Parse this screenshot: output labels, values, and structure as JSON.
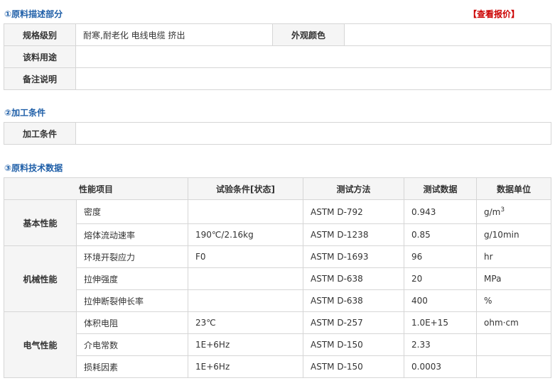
{
  "sections": {
    "desc_title": "①原料描述部分",
    "quote_link": "【查看报价】",
    "process_title": "②加工条件",
    "tech_title": "③原料技术数据"
  },
  "desc": {
    "spec_label": "规格级别",
    "spec_value": "耐寒,耐老化 电线电缆 挤出",
    "appearance_label": "外观颜色",
    "appearance_value": "",
    "usage_label": "该料用途",
    "usage_value": "",
    "remark_label": "备注说明",
    "remark_value": ""
  },
  "process": {
    "label": "加工条件",
    "value": ""
  },
  "tech": {
    "headers": [
      "性能项目",
      "试验条件[状态]",
      "测试方法",
      "测试数据",
      "数据单位"
    ],
    "groups": [
      {
        "name": "基本性能",
        "rows": [
          {
            "item": "密度",
            "cond": "",
            "method": "ASTM D-792",
            "value": "0.943",
            "unit": "g/m",
            "unit_sup": "3"
          },
          {
            "item": "熔体流动速率",
            "cond": "190℃/2.16kg",
            "method": "ASTM D-1238",
            "value": "0.85",
            "unit": "g/10min"
          }
        ]
      },
      {
        "name": "机械性能",
        "rows": [
          {
            "item": "环境开裂应力",
            "cond": "F0",
            "method": "ASTM D-1693",
            "value": "96",
            "unit": "hr"
          },
          {
            "item": "拉伸强度",
            "cond": "",
            "method": "ASTM D-638",
            "value": "20",
            "unit": "MPa"
          },
          {
            "item": "拉伸断裂伸长率",
            "cond": "",
            "method": "ASTM D-638",
            "value": "400",
            "unit": "%"
          }
        ]
      },
      {
        "name": "电气性能",
        "rows": [
          {
            "item": "体积电阻",
            "cond": "23℃",
            "method": "ASTM D-257",
            "value": "1.0E+15",
            "unit": "ohm·cm"
          },
          {
            "item": "介电常数",
            "cond": "1E+6Hz",
            "method": "ASTM D-150",
            "value": "2.33",
            "unit": ""
          },
          {
            "item": "损耗因素",
            "cond": "1E+6Hz",
            "method": "ASTM D-150",
            "value": "0.0003",
            "unit": ""
          }
        ]
      }
    ]
  }
}
